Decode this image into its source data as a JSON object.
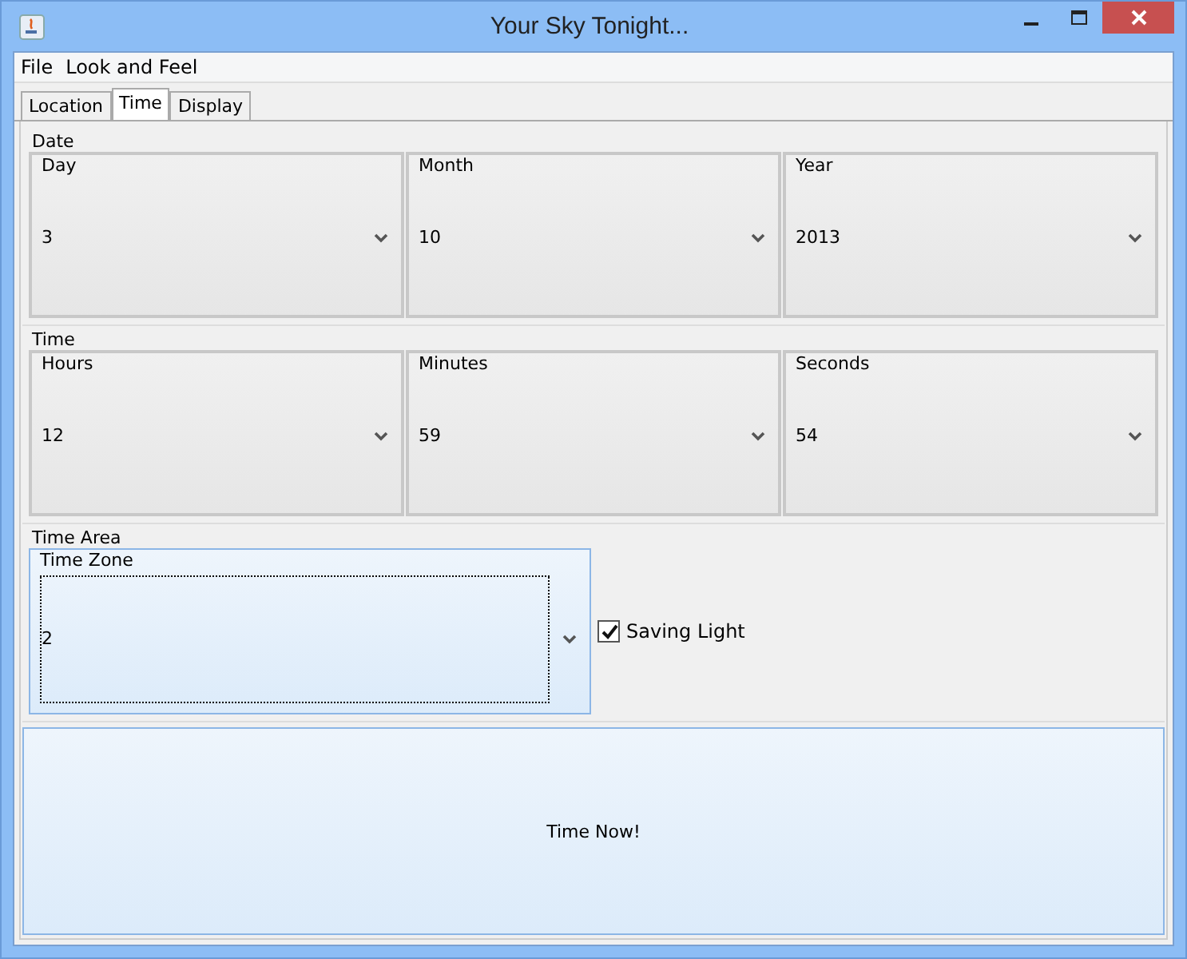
{
  "window": {
    "title": "Your Sky Tonight..."
  },
  "menu": [
    "File",
    "Look and Feel"
  ],
  "tabs": [
    {
      "label": "Location",
      "selected": false
    },
    {
      "label": "Time",
      "selected": true
    },
    {
      "label": "Display",
      "selected": false
    }
  ],
  "sections": [
    {
      "title": "Date",
      "combos": [
        {
          "label": "Day",
          "value": "3"
        },
        {
          "label": "Month",
          "value": "10"
        },
        {
          "label": "Year",
          "value": "2013"
        }
      ]
    },
    {
      "title": "Time",
      "combos": [
        {
          "label": "Hours",
          "value": "12"
        },
        {
          "label": "Minutes",
          "value": "59"
        },
        {
          "label": "Seconds",
          "value": "54"
        }
      ]
    }
  ],
  "time_area": {
    "title": "Time Area",
    "combo": {
      "label": "Time Zone",
      "value": "2",
      "focused": true
    },
    "checkbox": {
      "label": "Saving Light",
      "checked": true
    }
  },
  "button": "Time Now!"
}
